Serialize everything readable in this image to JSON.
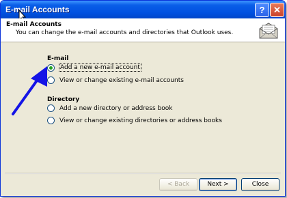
{
  "window": {
    "title": "E-mail Accounts"
  },
  "titlebar": {
    "help_label": "?",
    "close_label": "✕"
  },
  "header": {
    "title": "E-mail Accounts",
    "subtitle": "You can change the e-mail accounts and directories that Outlook uses.",
    "icon": "mail-envelope-icon"
  },
  "email_section": {
    "heading": "E-mail",
    "options": [
      {
        "label": "Add a new e-mail account",
        "selected": true
      },
      {
        "label": "View or change existing e-mail accounts",
        "selected": false
      }
    ]
  },
  "directory_section": {
    "heading": "Directory",
    "options": [
      {
        "label": "Add a new directory or address book",
        "selected": false
      },
      {
        "label": "View or change existing directories or address books",
        "selected": false
      }
    ]
  },
  "buttons": {
    "back": "< Back",
    "next": "Next >",
    "close": "Close"
  },
  "colors": {
    "titlebar": "#0050e0",
    "dialog_bg": "#ece9d8",
    "arrow": "#1414e6",
    "radio_selected": "#21a121"
  }
}
